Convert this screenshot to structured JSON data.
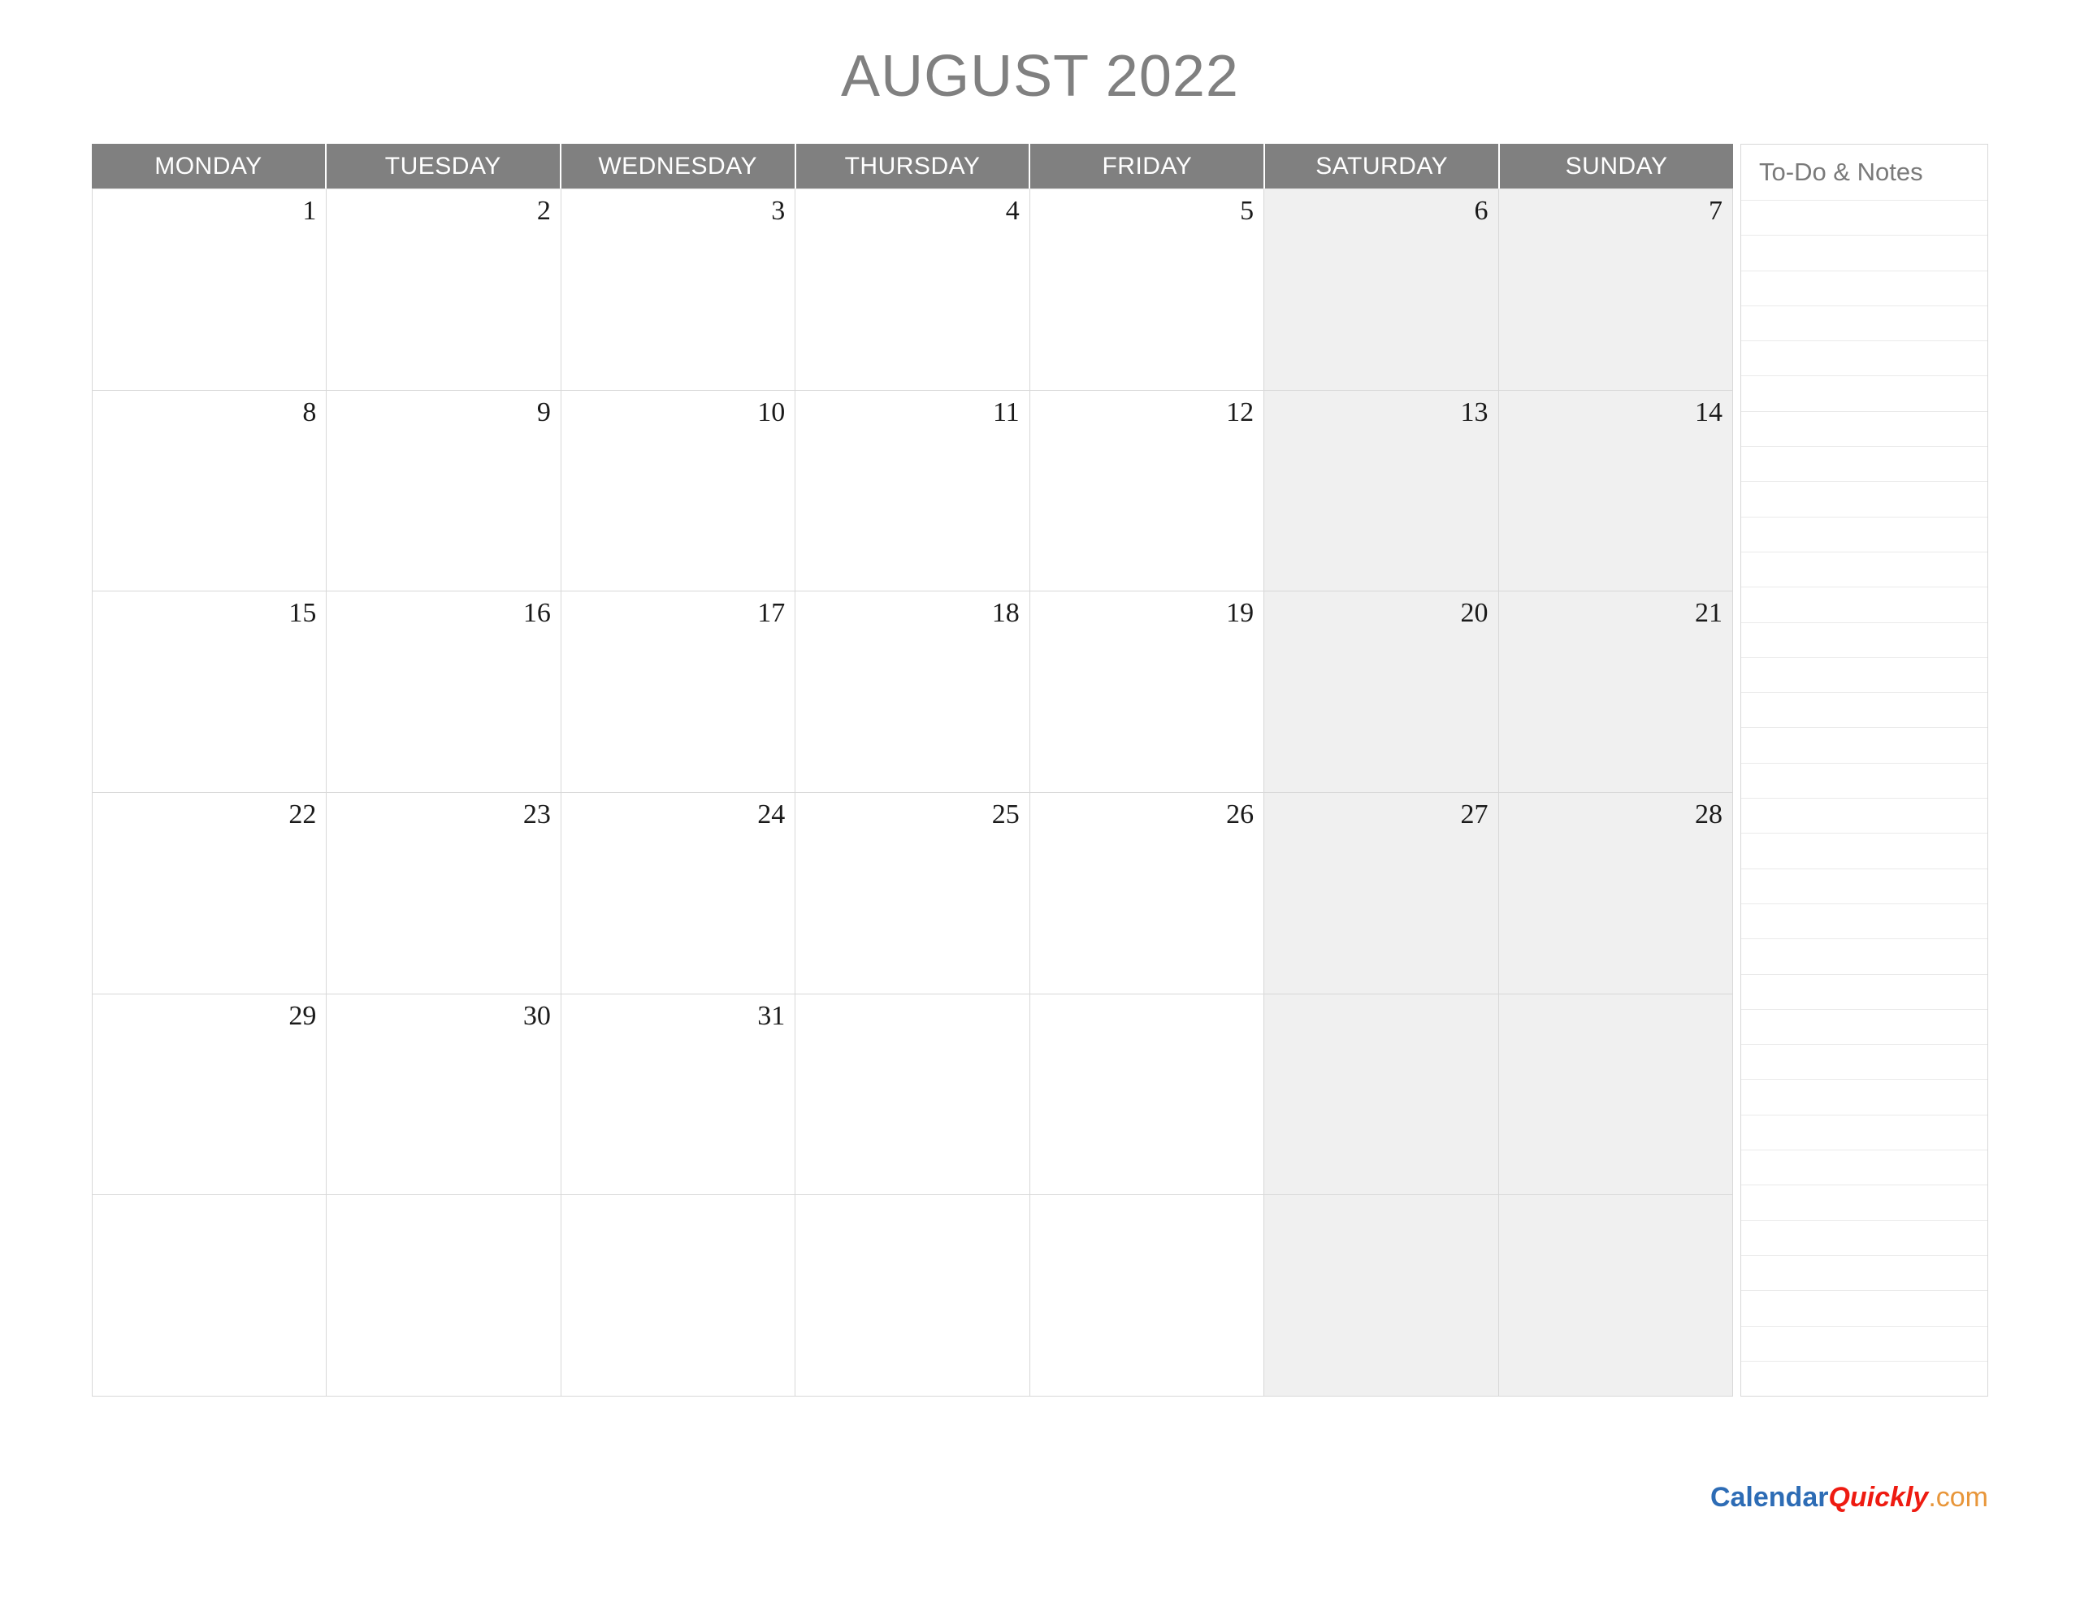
{
  "title": "AUGUST 2022",
  "weekdays": [
    {
      "label": "MONDAY",
      "weekend": false
    },
    {
      "label": "TUESDAY",
      "weekend": false
    },
    {
      "label": "WEDNESDAY",
      "weekend": false
    },
    {
      "label": "THURSDAY",
      "weekend": false
    },
    {
      "label": "FRIDAY",
      "weekend": false
    },
    {
      "label": "SATURDAY",
      "weekend": true
    },
    {
      "label": "SUNDAY",
      "weekend": true
    }
  ],
  "weeks": [
    [
      "1",
      "2",
      "3",
      "4",
      "5",
      "6",
      "7"
    ],
    [
      "8",
      "9",
      "10",
      "11",
      "12",
      "13",
      "14"
    ],
    [
      "15",
      "16",
      "17",
      "18",
      "19",
      "20",
      "21"
    ],
    [
      "22",
      "23",
      "24",
      "25",
      "26",
      "27",
      "28"
    ],
    [
      "29",
      "30",
      "31",
      "",
      "",
      "",
      ""
    ],
    [
      "",
      "",
      "",
      "",
      "",
      "",
      ""
    ]
  ],
  "notes": {
    "title": "To-Do & Notes",
    "line_count": 34
  },
  "logo": {
    "part1": "Calendar",
    "part2": "Quickly",
    "part3": ".com"
  },
  "colors": {
    "header_background": "#808080",
    "header_text": "#ffffff",
    "title_text": "#808080",
    "weekend_background": "#f0f0f0",
    "cell_border": "#d8d8d8",
    "note_line": "#eaeaea",
    "logo_calendar": "#2d6cb5",
    "logo_quickly": "#ee1b11",
    "logo_com": "#e8963a"
  }
}
